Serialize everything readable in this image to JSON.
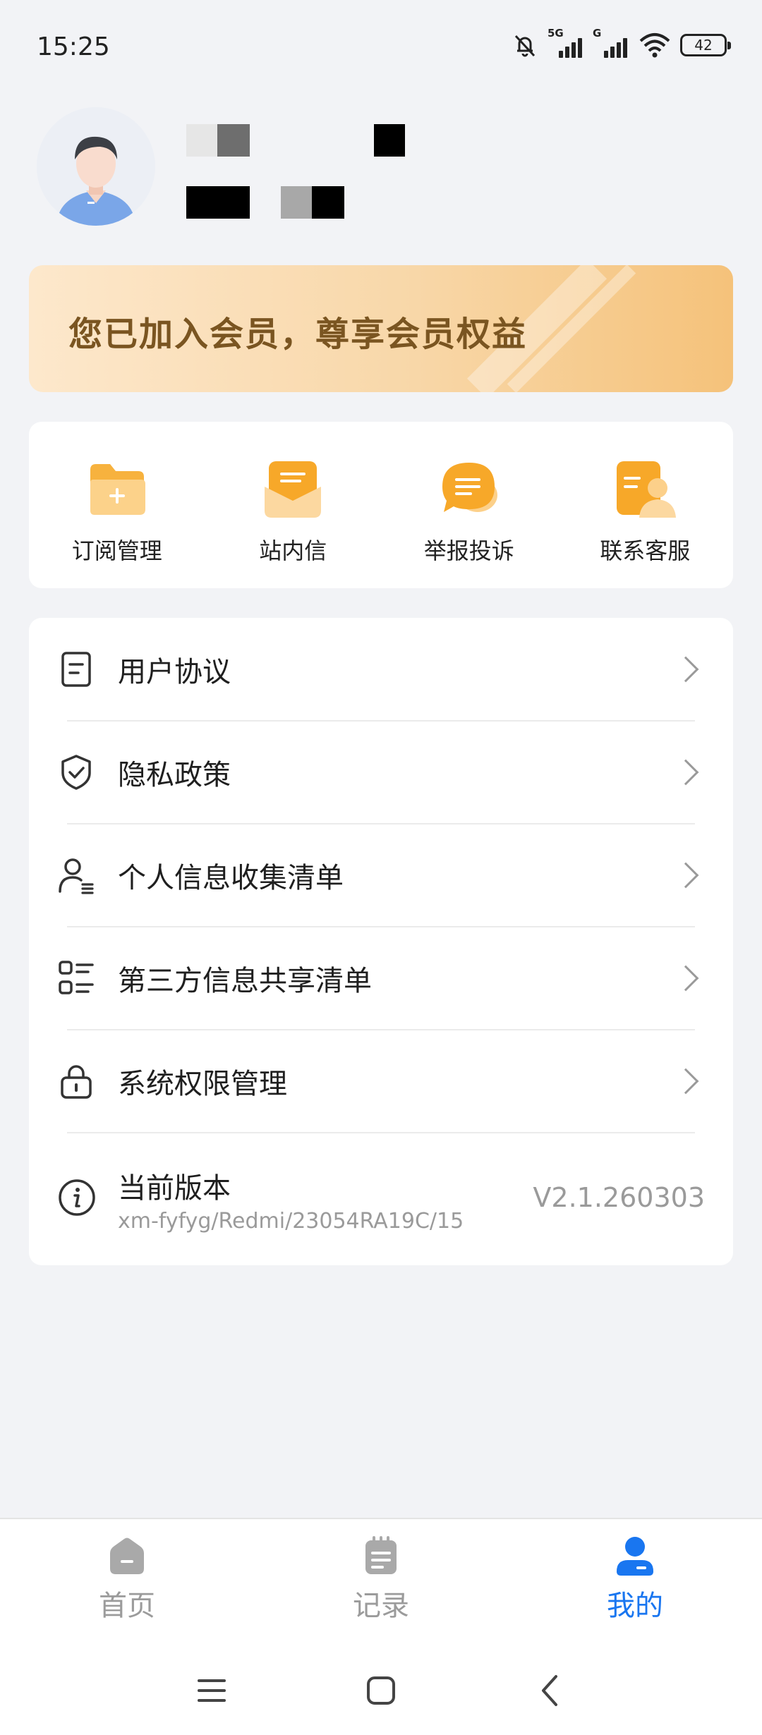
{
  "status_bar": {
    "time": "15:25",
    "network_1": "5G",
    "network_2": "G",
    "battery": "42",
    "icons": [
      "bell-off-icon",
      "signal-icon",
      "wifi-icon",
      "battery-icon"
    ]
  },
  "profile": {
    "avatar": "avatar-icon"
  },
  "vip_banner": {
    "text": "您已加入会员，尊享会员权益"
  },
  "quick_actions": [
    {
      "label": "订阅管理",
      "icon": "folder-add-icon"
    },
    {
      "label": "站内信",
      "icon": "mail-icon"
    },
    {
      "label": "举报投诉",
      "icon": "chat-bubble-icon"
    },
    {
      "label": "联系客服",
      "icon": "contact-card-icon"
    }
  ],
  "menu": {
    "items": [
      {
        "label": "用户协议",
        "icon": "document-icon"
      },
      {
        "label": "隐私政策",
        "icon": "shield-check-icon"
      },
      {
        "label": "个人信息收集清单",
        "icon": "user-list-icon"
      },
      {
        "label": "第三方信息共享清单",
        "icon": "grid-list-icon"
      },
      {
        "label": "系统权限管理",
        "icon": "lock-icon"
      }
    ],
    "version": {
      "title": "当前版本",
      "subtitle": "xm-fyfyg/Redmi/23054RA19C/15",
      "number": "V2.1.260303",
      "icon": "info-icon"
    }
  },
  "bottom_nav": {
    "items": [
      {
        "label": "首页",
        "icon": "home-icon",
        "active": false
      },
      {
        "label": "记录",
        "icon": "clipboard-icon",
        "active": false
      },
      {
        "label": "我的",
        "icon": "user-icon",
        "active": true
      }
    ]
  },
  "colors": {
    "accent": "#1976f0",
    "vip_text": "#7a5521",
    "icon_orange": "#f7a829",
    "background": "#f2f3f6"
  }
}
